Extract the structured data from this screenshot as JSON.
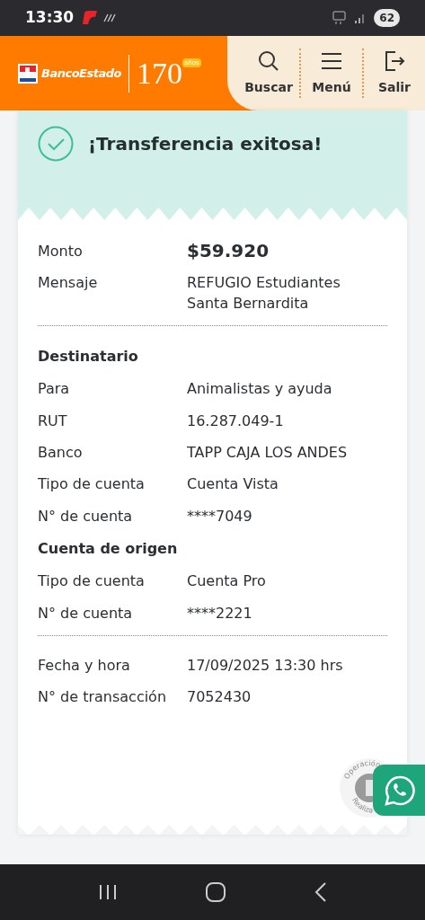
{
  "status_bar": {
    "time": "13:30",
    "battery": "62"
  },
  "header": {
    "logo": {
      "brand": "BancoEstado",
      "anniversary": "170",
      "anniversary_suffix": "años"
    },
    "actions": [
      {
        "label": "Buscar",
        "kind": "search"
      },
      {
        "label": "Menú",
        "kind": "menu"
      },
      {
        "label": "Salir",
        "kind": "exit"
      }
    ]
  },
  "banner": {
    "title": "¡Transferencia exitosa!"
  },
  "groups": [
    {
      "sections": [
        {
          "rows": [
            {
              "label": "Monto",
              "value": "$59.920",
              "kind": "amount"
            },
            {
              "label": "Mensaje",
              "value": "REFUGIO Estudiantes Santa Bernardita",
              "kind": "text"
            }
          ]
        }
      ]
    },
    {
      "sections": [
        {
          "title": "Destinatario",
          "rows": [
            {
              "label": "Para",
              "value": "Animalistas y ayuda",
              "kind": "text"
            },
            {
              "label": "RUT",
              "value": "16.287.049-1",
              "kind": "text"
            },
            {
              "label": "Banco",
              "value": "TAPP CAJA LOS ANDES",
              "kind": "text"
            },
            {
              "label": "Tipo de cuenta",
              "value": "Cuenta Vista",
              "kind": "text"
            },
            {
              "label": "N° de cuenta",
              "value": "****7049",
              "kind": "text"
            }
          ]
        },
        {
          "title": "Cuenta de origen",
          "rows": [
            {
              "label": "Tipo de cuenta",
              "value": "Cuenta Pro",
              "kind": "text"
            },
            {
              "label": "N° de cuenta",
              "value": "****2221",
              "kind": "text"
            }
          ]
        }
      ]
    },
    {
      "sections": [
        {
          "rows": [
            {
              "label": "Fecha y hora",
              "value": "17/09/2025 13:30 hrs",
              "kind": "text"
            },
            {
              "label": "N° de transacción",
              "value": "7052430",
              "kind": "text"
            }
          ]
        }
      ]
    }
  ],
  "stamp": {
    "top": "Operación",
    "bottom": "Realiza"
  }
}
